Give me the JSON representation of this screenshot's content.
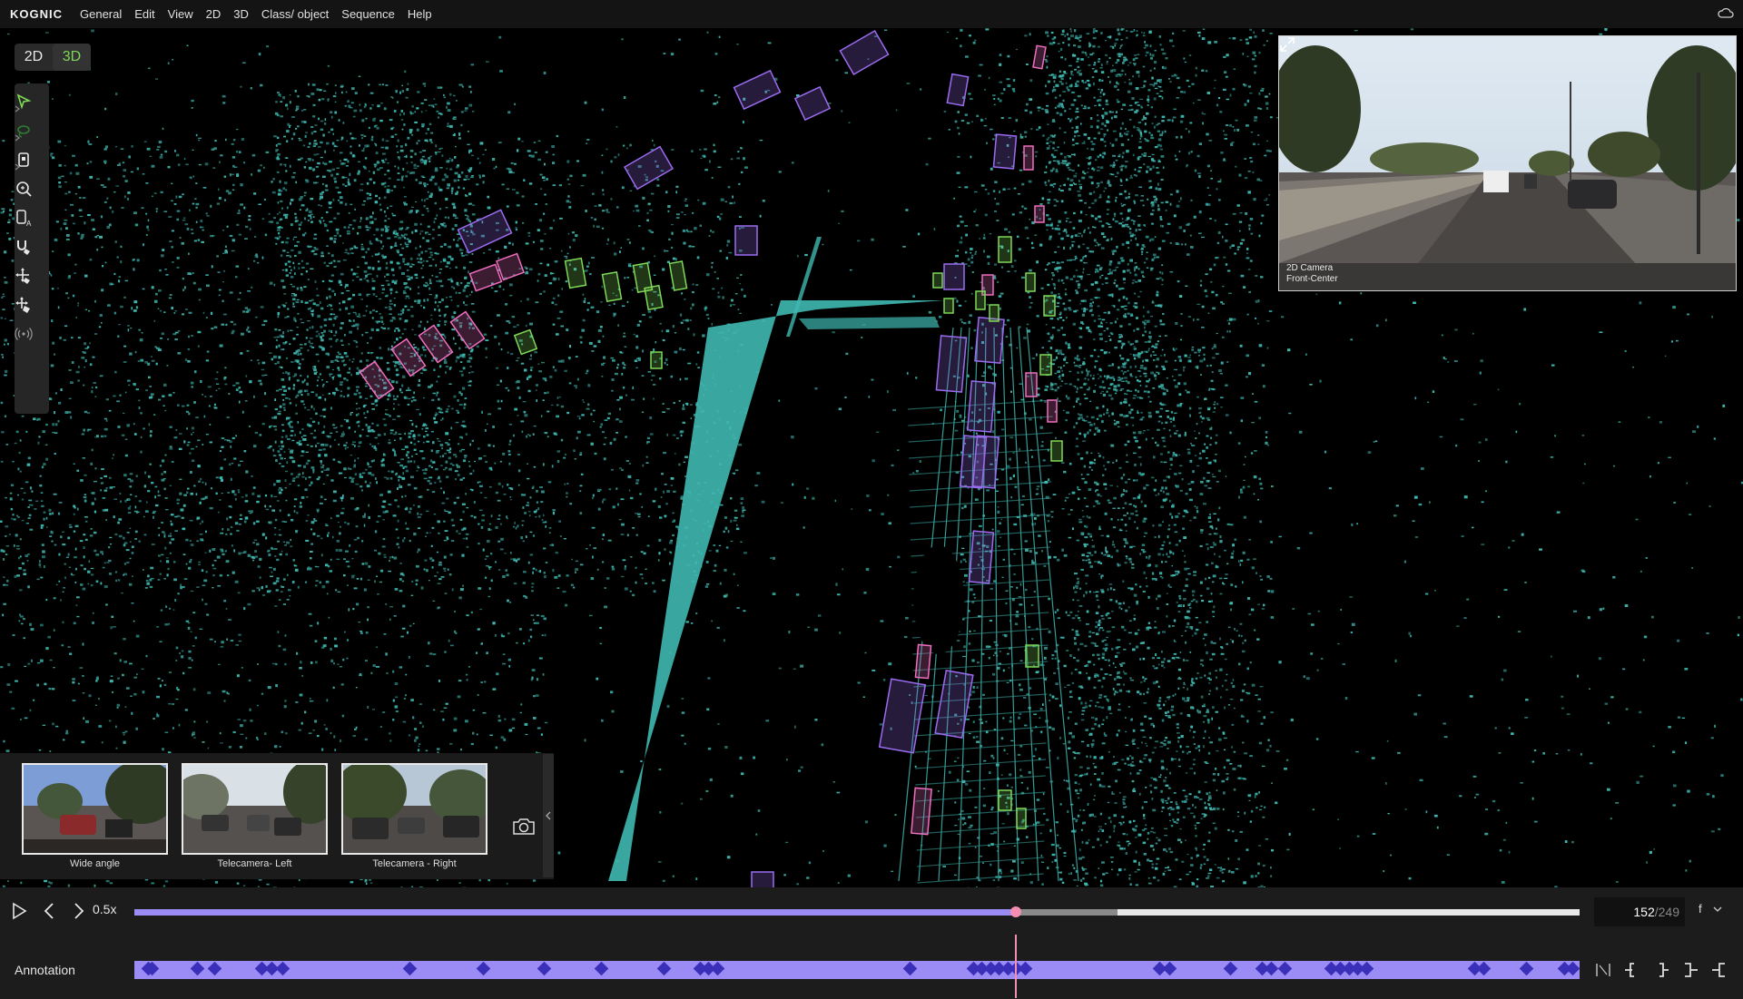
{
  "app": {
    "brand": "KOGNIC"
  },
  "menu": [
    "General",
    "Edit",
    "View",
    "2D",
    "3D",
    "Class/ object",
    "Sequence",
    "Help"
  ],
  "mode_toggle": {
    "two_d": "2D",
    "three_d": "3D",
    "active": "3D",
    "active_color": "#7ed957"
  },
  "tools": [
    {
      "name": "select-tool",
      "icon": "cursor-icon"
    },
    {
      "name": "lasso-tool",
      "icon": "lasso-icon"
    },
    {
      "name": "cuboid-tool",
      "icon": "cuboid-icon"
    },
    {
      "name": "zoom-tool",
      "icon": "zoom-icon"
    },
    {
      "name": "auto-label-tool",
      "icon": "auto-label-icon"
    },
    {
      "name": "magnet-paint-tool",
      "icon": "magnet-icon"
    },
    {
      "name": "move-tool",
      "icon": "move-icon"
    },
    {
      "name": "multi-move-tool",
      "icon": "multi-move-icon"
    },
    {
      "name": "sensor-tool",
      "icon": "sensor-icon"
    }
  ],
  "main_camera": {
    "label_line1": "2D Camera",
    "label_line2": "Front-Center"
  },
  "thumbnails": [
    {
      "label": "Wide angle"
    },
    {
      "label": "Telecamera- Left"
    },
    {
      "label": "Telecamera - Right"
    }
  ],
  "playback": {
    "speed": "0.5x",
    "current_frame": "152",
    "total_frames": "/249",
    "progress": 0.61,
    "buffered": 0.68,
    "f_label": "f"
  },
  "annotation": {
    "label": "Annotation",
    "track_color": "#9b8cf5",
    "keyframe_color": "#3a2fb8"
  },
  "colors": {
    "point_cloud": "#3fb8b0",
    "box_purple": "#9b6cf0",
    "box_pink": "#f06ec0",
    "box_green": "#7ed957"
  }
}
